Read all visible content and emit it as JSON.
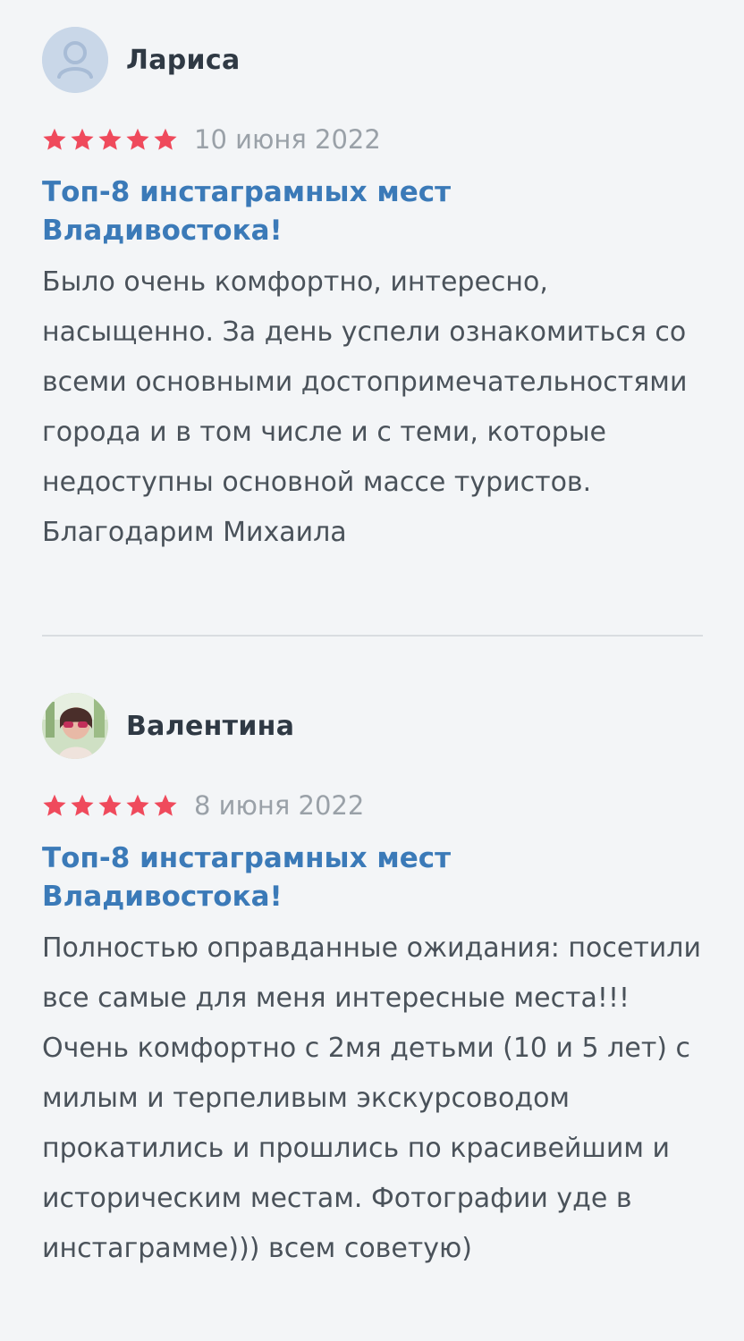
{
  "reviews": [
    {
      "name": "Лариса",
      "avatar_icon": "user-placeholder-icon",
      "rating": 5,
      "date": "10 июня 2022",
      "title": "Топ-8 инстаграмных мест Владивостока!",
      "text": "Было очень комфортно, интересно, насыщенно. За день успели ознакомиться со всеми основными достопримечательностями города и в том числе и с теми, которые недоступны основной массе туристов. Благодарим Михаила"
    },
    {
      "name": "Валентина",
      "avatar_icon": "user-photo",
      "rating": 5,
      "date": "8 июня 2022",
      "title": "Топ-8 инстаграмных мест Владивостока!",
      "text": "Полностью оправданные ожидания: посетили все самые для меня интересные места!!! Очень комфортно с 2мя детьми (10 и 5 лет) с милым и терпеливым экскурсоводом прокатились и прошлись по красивейшим и историческим местам. Фотографии уде в инстаграмме))) всем советую)"
    }
  ],
  "colors": {
    "background": "#f3f5f7",
    "star": "#ef4a5c",
    "title": "#3b7ab8",
    "date": "#9aa1a8",
    "divider": "#d9dde1"
  }
}
